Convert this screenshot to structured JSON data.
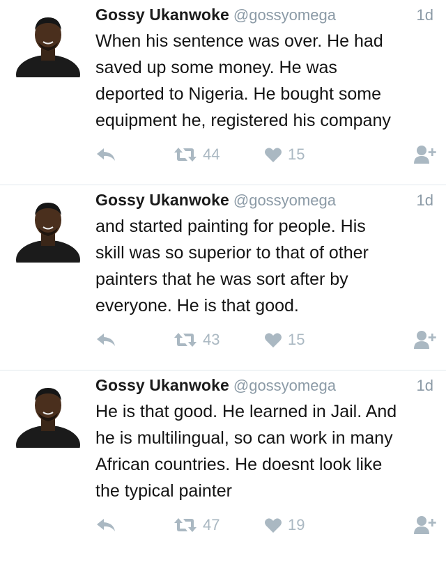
{
  "tweets": [
    {
      "author_name": "Gossy Ukanwoke",
      "handle": "@gossyomega",
      "time": "1d",
      "text": "When his sentence was over. He had\nsaved up some money. He was\ndeported to Nigeria. He bought some\nequipment he, registered his company",
      "retweets": "44",
      "likes": "15"
    },
    {
      "author_name": "Gossy Ukanwoke",
      "handle": "@gossyomega",
      "time": "1d",
      "text": "and started painting for people. His\nskill was so superior to that of other\npainters that he was sort after by\neveryone. He is that good.",
      "retweets": "43",
      "likes": "15"
    },
    {
      "author_name": "Gossy Ukanwoke",
      "handle": "@gossyomega",
      "time": "1d",
      "text": "He is that good. He learned in Jail. And\nhe is multilingual, so can work in many\nAfrican countries. He doesnt look like\nthe typical  painter",
      "retweets": "47",
      "likes": "19"
    }
  ],
  "icons": {
    "reply": "reply-icon",
    "retweet": "retweet-icon",
    "like": "heart-icon",
    "follow": "follow-user-icon"
  },
  "colors": {
    "action_gray": "#aab8c2",
    "meta_gray": "#8b9aa6",
    "divider": "#e1e8ed"
  }
}
